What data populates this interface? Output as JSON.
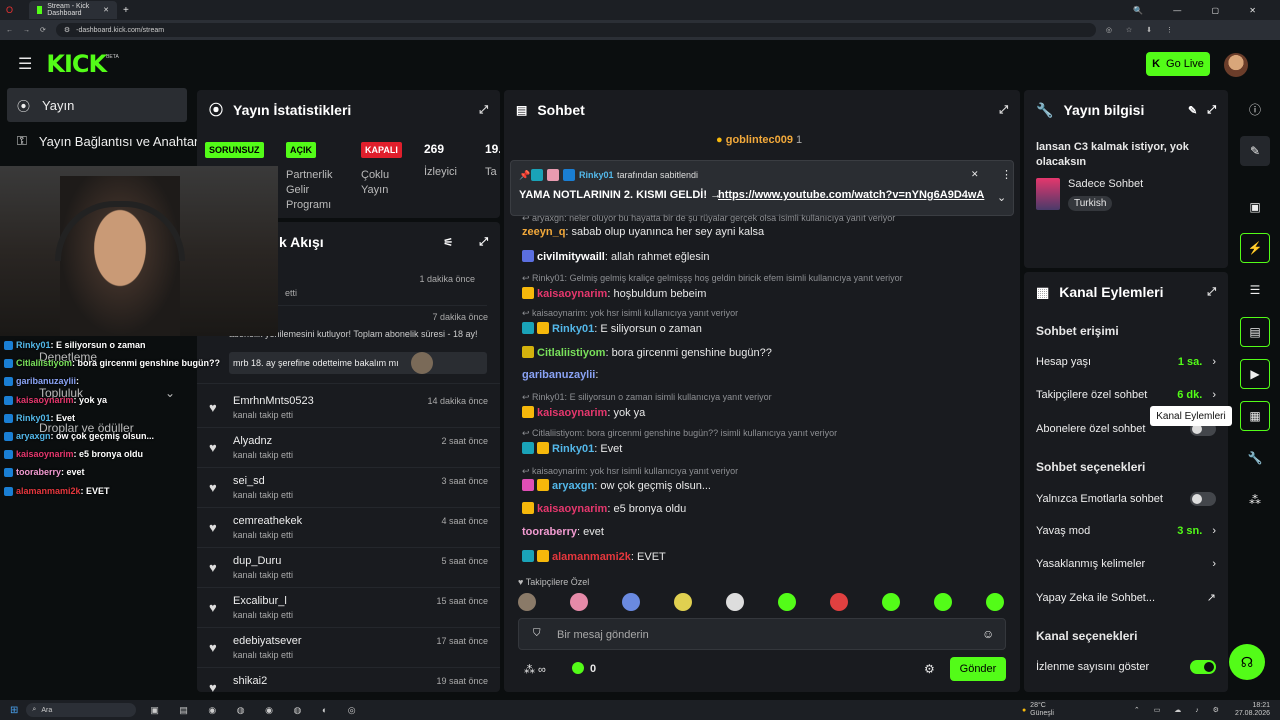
{
  "browser": {
    "tab_title": "Stream - Kick Dashboard",
    "url": "-dashboard.kick.com/stream"
  },
  "topnav": {
    "logo": "KICK",
    "beta": "BETA",
    "go_live": "Go Live"
  },
  "sidenav": {
    "items": [
      {
        "label": "Yayın"
      },
      {
        "label": "Yayın Bağlantısı ve Anahtar"
      },
      {
        "label": "Denetleme"
      },
      {
        "label": "Topluluk"
      },
      {
        "label": "Droplar ve ödüller"
      }
    ]
  },
  "stats": {
    "title": "Yayın İstatistikleri",
    "badges": [
      "SORUNSUZ",
      "AÇIK",
      "KAPALI"
    ],
    "sub1": "Partnerlik Gelir Programı",
    "sub2": "Çoklu Yayın",
    "viewers": "269",
    "viewers_label": "İzleyici",
    "partial": "19.",
    "partial_label": "Ta"
  },
  "feed": {
    "title": "k Akışı",
    "items": [
      {
        "name": "",
        "sub": "etti",
        "time": "1 dakika önce"
      },
      {
        "name": "",
        "sub": "",
        "time": "7 dakika önce",
        "note": "abonelik yenilemesini kutluyor! Toplam abonelik süresi - 18 ay!",
        "msg": "mrb 18. ay şerefine odetteime bakalım mı"
      },
      {
        "name": "EmrhnMnts0523",
        "sub": "kanalı takip etti",
        "time": "14 dakika önce"
      },
      {
        "name": "Alyadnz",
        "sub": "kanalı takip etti",
        "time": "2 saat önce"
      },
      {
        "name": "sei_sd",
        "sub": "kanalı takip etti",
        "time": "3 saat önce"
      },
      {
        "name": "cemreathekek",
        "sub": "kanalı takip etti",
        "time": "4 saat önce"
      },
      {
        "name": "dup_Duru",
        "sub": "kanalı takip etti",
        "time": "5 saat önce"
      },
      {
        "name": "Excalibur_l",
        "sub": "kanalı takip etti",
        "time": "15 saat önce"
      },
      {
        "name": "edebiyatsever",
        "sub": "kanalı takip etti",
        "time": "17 saat önce"
      },
      {
        "name": "shikai2",
        "sub": "",
        "time": "19 saat önce"
      }
    ]
  },
  "chat": {
    "title": "Sohbet",
    "top_user": "goblintec009",
    "top_count": "1",
    "pinned_by": "Rinky01",
    "pinned_label": "tarafından sabitlendi",
    "pinned_text": "YAMA NOTLARININ 2. KISMI GELDİ! →",
    "pinned_link": "https://www.youtube.com/watch?v=nYNg6A9D4wA",
    "lines": [
      {
        "kind": "reply",
        "text": "aryaxgn: neler oluyor bu hayatta bir de şu rüyalar gerçek olsa",
        "suffix": "isimli kullanıcıya yanıt veriyor"
      },
      {
        "kind": "msg",
        "user": "zeeyn_q",
        "color": "#f2a93b",
        "text": "sabab olup uyanınca her sey ayni kalsa"
      },
      {
        "kind": "msg",
        "user": "civilmitywaill",
        "color": "#ffffff",
        "text": "allah rahmet eğlesin",
        "badge": "50"
      },
      {
        "kind": "reply",
        "text": "Rinky01: Gelmiş gelmiş kraliçe gelmişşş hoş geldin biricik efem isimli kullanıcıya yanıt veriyor"
      },
      {
        "kind": "msg",
        "user": "kaisaoynarim",
        "color": "#e5376d",
        "text": "hoşbuldum bebeim"
      },
      {
        "kind": "reply",
        "text": "kaisaoynarim: yok hsr isimli kullanıcıya yanıt veriyor"
      },
      {
        "kind": "msg",
        "user": "Rinky01",
        "color": "#53b8ea",
        "text": "E siliyorsun o zaman",
        "badge": "30"
      },
      {
        "kind": "msg",
        "user": "Citlaliistiyom",
        "color": "#79e05b",
        "text": "bora gircenmi genshine bugün??",
        "badge": "12"
      },
      {
        "kind": "msg",
        "user": "garibanuzaylii",
        "color": "#8aa3f5",
        "text": ""
      },
      {
        "kind": "reply",
        "text": "Rinky01: E siliyorsun o zaman isimli kullanıcıya yanıt veriyor"
      },
      {
        "kind": "msg",
        "user": "kaisaoynarim",
        "color": "#e5376d",
        "text": "yok ya"
      },
      {
        "kind": "reply",
        "text": "Citlaliistiyom: bora gircenmi genshine bugün?? isimli kullanıcıya yanıt veriyor"
      },
      {
        "kind": "msg",
        "user": "Rinky01",
        "color": "#53b8ea",
        "text": "Evet",
        "badge": "30"
      },
      {
        "kind": "reply",
        "text": "kaisaoynarim: yok hsr isimli kullanıcıya yanıt veriyor"
      },
      {
        "kind": "msg",
        "user": "aryaxgn",
        "color": "#53b8ea",
        "text": "ow çok geçmiş olsun...",
        "badge": "25"
      },
      {
        "kind": "msg",
        "user": "kaisaoynarim",
        "color": "#e5376d",
        "text": "e5 bronya oldu"
      },
      {
        "kind": "msg",
        "user": "tooraberry",
        "color": "#f29bd1",
        "text": "evet"
      },
      {
        "kind": "msg",
        "user": "alamanmami2k",
        "color": "#e5373d",
        "text": "EVET",
        "badge": "30"
      }
    ],
    "followers_only": "Takipçilere Özel",
    "input_placeholder": "Bir mesaj gönderin",
    "count": "0",
    "send": "Gönder"
  },
  "info": {
    "title": "Yayın bilgisi",
    "stream_title": "lansan C3 kalmak istiyor, yok olacaksın",
    "category": "Sadece Sohbet",
    "language": "Turkish"
  },
  "actions": {
    "title": "Kanal Eylemleri",
    "tooltip": "Kanal Eylemleri",
    "sec1": "Sohbet erişimi",
    "rows1": [
      {
        "label": "Hesap yaşı",
        "value": "1 sa."
      },
      {
        "label": "Takipçilere özel sohbet",
        "value": "6 dk."
      },
      {
        "label": "Abonelere özel sohbet",
        "value": ""
      }
    ],
    "sec2": "Sohbet seçenekleri",
    "rows2": [
      {
        "label": "Yalnızca Emotlarla sohbet",
        "value": ""
      },
      {
        "label": "Yavaş mod",
        "value": "3 sn."
      },
      {
        "label": "Yasaklanmış kelimeler",
        "value": ""
      },
      {
        "label": "Yapay Zeka ile Sohbet...",
        "value": ""
      }
    ],
    "sec3": "Kanal seçenekleri",
    "rows3": [
      {
        "label": "İzlenme sayısını göster",
        "value": ""
      }
    ]
  },
  "overlay": {
    "lines": [
      {
        "user": "Rinky01",
        "text": ": E siliyorsun o zaman",
        "color": "#53b8ea"
      },
      {
        "user": "Citlaliistiyom",
        "text": ": bora gircenmi genshine bugün??",
        "color": "#79e05b"
      },
      {
        "user": "garibanuzaylii",
        "text": ":",
        "color": "#8aa3f5"
      },
      {
        "user": "kaisaoynarim",
        "text": ": yok ya",
        "color": "#e5376d"
      },
      {
        "user": "Rinky01",
        "text": ": Evet",
        "color": "#53b8ea"
      },
      {
        "user": "aryaxgn",
        "text": ": ow çok geçmiş olsun...",
        "color": "#53b8ea"
      },
      {
        "user": "kaisaoynarim",
        "text": ": e5 bronya oldu",
        "color": "#e5376d"
      },
      {
        "user": "tooraberry",
        "text": ": evet",
        "color": "#f29bd1"
      },
      {
        "user": "alamanmami2k",
        "text": ": EVET",
        "color": "#e5373d"
      }
    ]
  },
  "taskbar": {
    "search": "Ara",
    "weather_temp": "28°C",
    "weather_desc": "Güneşli",
    "time": "18:21",
    "date": "27.08.2026"
  },
  "colors": {
    "accent": "#53fc18",
    "panel": "#191b1f",
    "bg": "#0b0e0f"
  }
}
